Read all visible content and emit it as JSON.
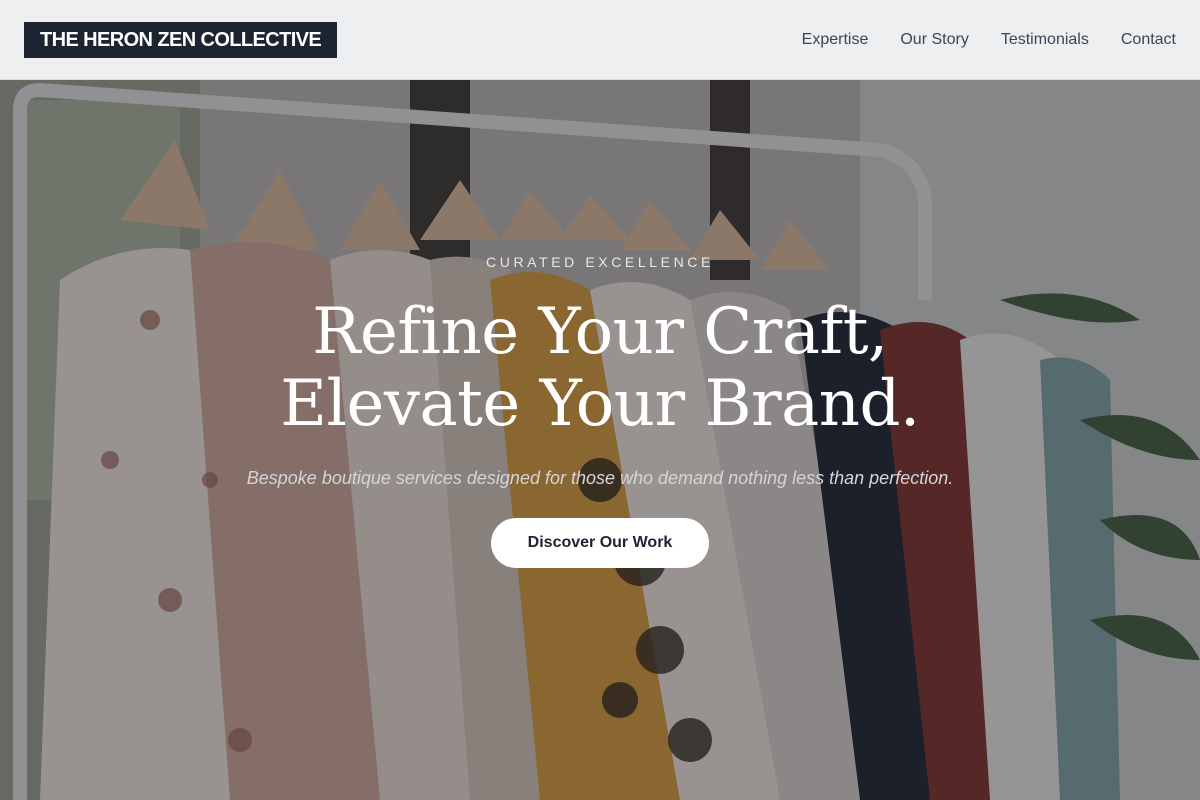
{
  "header": {
    "logo_text": "THE HERON ZEN COLLECTIVE",
    "nav": [
      {
        "label": "Expertise"
      },
      {
        "label": "Our Story"
      },
      {
        "label": "Testimonials"
      },
      {
        "label": "Contact"
      }
    ]
  },
  "hero": {
    "eyebrow": "CURATED EXCELLENCE",
    "headline_line1": "Refine Your Craft,",
    "headline_line2": "Elevate Your Brand.",
    "subtitle": "Bespoke boutique services designed for those who demand nothing less than perfection.",
    "cta_label": "Discover Our Work",
    "background_image": "clothing-rack-photo"
  },
  "colors": {
    "header_bg": "#eeeff1",
    "logo_bg": "#1c2431",
    "nav_text": "#3a4656",
    "cta_bg": "#ffffff",
    "cta_text": "#1c2431"
  }
}
